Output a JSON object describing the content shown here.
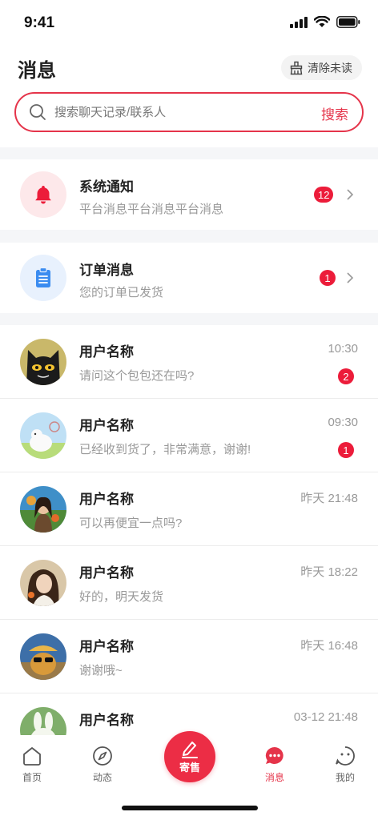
{
  "status_bar": {
    "time": "9:41"
  },
  "header": {
    "title": "消息",
    "clear_label": "清除未读"
  },
  "search": {
    "placeholder": "搜索聊天记录/联系人",
    "button_label": "搜索"
  },
  "notices": [
    {
      "title": "系统通知",
      "subtitle": "平台消息平台消息平台消息",
      "badge": "12",
      "icon": "bell-icon"
    },
    {
      "title": "订单消息",
      "subtitle": "您的订单已发货",
      "badge": "1",
      "icon": "clipboard-icon"
    }
  ],
  "chats": [
    {
      "name": "用户名称",
      "message": "请问这个包包还在吗?",
      "time": "10:30",
      "badge": "2"
    },
    {
      "name": "用户名称",
      "message": "已经收到货了，非常满意，谢谢!",
      "time": "09:30",
      "badge": "1"
    },
    {
      "name": "用户名称",
      "message": "可以再便宜一点吗?",
      "time": "昨天 21:48"
    },
    {
      "name": "用户名称",
      "message": "好的，明天发货",
      "time": "昨天 18:22"
    },
    {
      "name": "用户名称",
      "message": "谢谢哦~",
      "time": "昨天 16:48"
    },
    {
      "name": "用户名称",
      "message": "",
      "time": "03-12 21:48"
    }
  ],
  "tabbar": {
    "home": "首页",
    "feed": "动态",
    "sell": "寄售",
    "messages": "消息",
    "mine": "我的"
  },
  "colors": {
    "accent": "#e5344a",
    "badge": "#ec1c3a",
    "order_icon": "#3b8cf0"
  }
}
